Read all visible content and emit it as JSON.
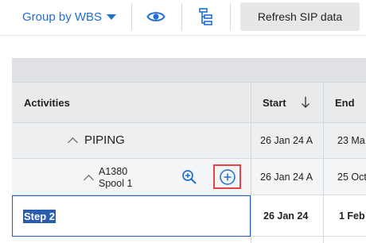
{
  "toolbar": {
    "group_by_label": "Group by WBS",
    "visibility_icon": "eye-icon",
    "hierarchy_icon": "hierarchy-icon",
    "refresh_label": "Refresh SIP data",
    "accent_color": "#1f6fd1"
  },
  "grid": {
    "columns": [
      {
        "label": "Activities"
      },
      {
        "label": "Start",
        "sort_icon": "arrow-down-icon"
      },
      {
        "label": "End"
      }
    ],
    "rows": [
      {
        "type": "wbs",
        "label": "PIPING",
        "start": "26 Jan 24 A",
        "end": "23 Ma"
      },
      {
        "type": "activity",
        "code": "A1380",
        "name": "Spool 1",
        "start": "26 Jan 24 A",
        "end": "25 Oct"
      },
      {
        "type": "step",
        "name": "Step 2",
        "start": "26 Jan 24",
        "end": "1 Feb"
      }
    ]
  }
}
